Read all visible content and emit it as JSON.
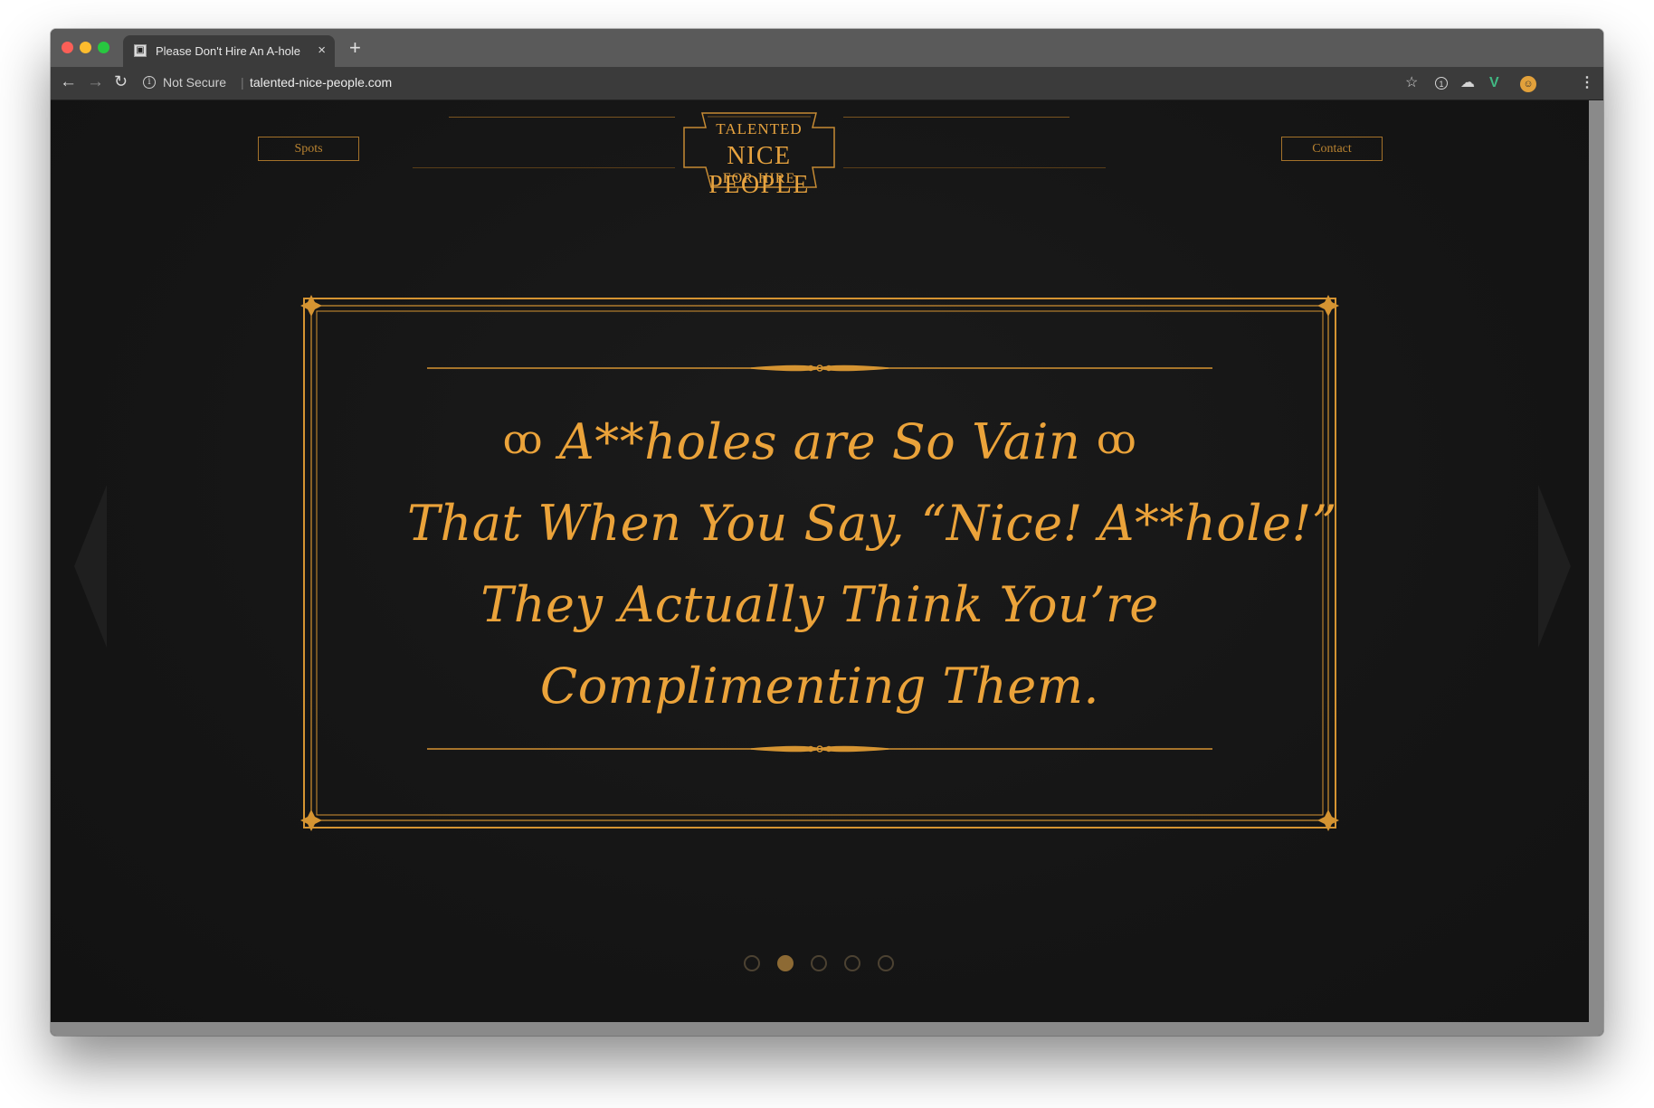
{
  "browser": {
    "tab_title": "Please Don't Hire An A-hole",
    "tab_close": "×",
    "new_tab": "+",
    "security_label": "Not Secure",
    "url": "talented-nice-people.com"
  },
  "nav": {
    "spots": "Spots",
    "contact": "Contact"
  },
  "logo": {
    "line1": "TALENTED",
    "line2": "NICE PEOPLE",
    "line3": "FOR HIRE"
  },
  "slide": {
    "lines": [
      "A**holes are So Vain",
      "That When You Say, “Nice! A**hole!”",
      "They Actually Think You’re",
      "Complimenting Them."
    ],
    "accent_color": "#e49a2e"
  },
  "carousel": {
    "count": 5,
    "active_index": 1
  },
  "icons": {
    "back": "back-arrow-icon",
    "forward": "forward-arrow-icon",
    "reload": "reload-icon",
    "info": "info-icon",
    "star": "star-icon",
    "menu": "kebab-menu-icon"
  }
}
